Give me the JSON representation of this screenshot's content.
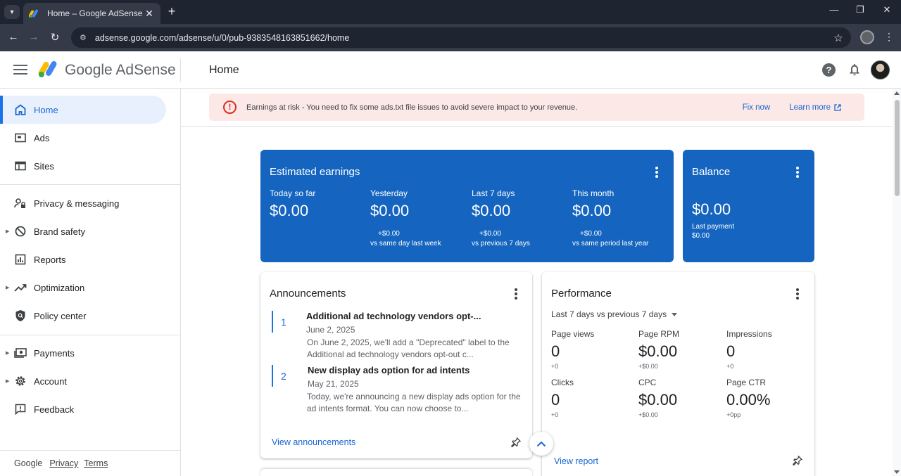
{
  "browser": {
    "tab_title": "Home – Google AdSense",
    "url": "adsense.google.com/adsense/u/0/pub-9383548163851662/home"
  },
  "header": {
    "brand_google": "Google",
    "brand_product": "AdSense",
    "page_title": "Home",
    "help_glyph": "?"
  },
  "sidebar": {
    "items": [
      {
        "label": "Home",
        "icon": "home-icon"
      },
      {
        "label": "Ads",
        "icon": "ads-icon"
      },
      {
        "label": "Sites",
        "icon": "sites-icon"
      },
      {
        "label": "Privacy & messaging",
        "icon": "privacy-icon"
      },
      {
        "label": "Brand safety",
        "icon": "block-icon"
      },
      {
        "label": "Reports",
        "icon": "bar-chart-icon"
      },
      {
        "label": "Optimization",
        "icon": "trending-up-icon"
      },
      {
        "label": "Policy center",
        "icon": "shield-icon"
      },
      {
        "label": "Payments",
        "icon": "payments-icon"
      },
      {
        "label": "Account",
        "icon": "gear-icon"
      },
      {
        "label": "Feedback",
        "icon": "feedback-icon"
      }
    ],
    "footer": {
      "google": "Google",
      "privacy": "Privacy",
      "terms": "Terms"
    }
  },
  "alert": {
    "message": "Earnings at risk - You need to fix some ads.txt file issues to avoid severe impact to your revenue.",
    "fix_now": "Fix now",
    "learn_more": "Learn more"
  },
  "estimated_earnings": {
    "title": "Estimated earnings",
    "metrics": [
      {
        "label": "Today so far",
        "value": "$0.00",
        "delta": "",
        "compare": ""
      },
      {
        "label": "Yesterday",
        "value": "$0.00",
        "delta": "+$0.00",
        "compare": "vs same day last week"
      },
      {
        "label": "Last 7 days",
        "value": "$0.00",
        "delta": "+$0.00",
        "compare": "vs previous 7 days"
      },
      {
        "label": "This month",
        "value": "$0.00",
        "delta": "+$0.00",
        "compare": "vs same period last year"
      }
    ]
  },
  "balance": {
    "title": "Balance",
    "value": "$0.00",
    "last_payment_label": "Last payment",
    "last_payment_value": "$0.00"
  },
  "announcements": {
    "title": "Announcements",
    "items": [
      {
        "num": "1",
        "headline": "Additional ad technology vendors opt-...",
        "date": "June 2, 2025",
        "desc": "On June 2, 2025, we'll add a \"Deprecated\" label to the Additional ad technology vendors opt-out c..."
      },
      {
        "num": "2",
        "headline": "New display ads option for ad intents",
        "date": "May 21, 2025",
        "desc": "Today, we're announcing a new display ads option for the ad intents format. You can now choose to..."
      }
    ],
    "link": "View announcements"
  },
  "performance": {
    "title": "Performance",
    "range": "Last 7 days vs previous 7 days",
    "metrics": [
      {
        "label": "Page views",
        "value": "0",
        "delta": "+0"
      },
      {
        "label": "Page RPM",
        "value": "$0.00",
        "delta": "+$0.00"
      },
      {
        "label": "Impressions",
        "value": "0",
        "delta": "+0"
      },
      {
        "label": "Clicks",
        "value": "0",
        "delta": "+0"
      },
      {
        "label": "CPC",
        "value": "$0.00",
        "delta": "+$0.00"
      },
      {
        "label": "Page CTR",
        "value": "0.00%",
        "delta": "+0pp"
      }
    ],
    "link": "View report"
  },
  "colors": {
    "accent": "#1a73e8",
    "card_blue": "#1565c0",
    "alert_bg": "#fce8e6",
    "alert_icon": "#d93025"
  }
}
